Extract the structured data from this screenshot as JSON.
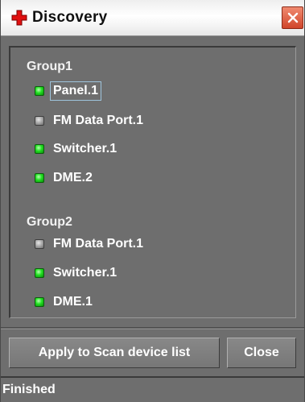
{
  "window": {
    "title": "Discovery",
    "title_icon": "red-plus-app-icon",
    "close_icon": "close-icon"
  },
  "groups": [
    {
      "label": "Group1",
      "devices": [
        {
          "name": "Panel.1",
          "status": "online",
          "focused": true
        },
        {
          "name": "FM Data Port.1",
          "status": "offline",
          "focused": false
        },
        {
          "name": "Switcher.1",
          "status": "online",
          "focused": false
        },
        {
          "name": "DME.2",
          "status": "online",
          "focused": false
        }
      ]
    },
    {
      "label": "Group2",
      "devices": [
        {
          "name": "FM Data Port.1",
          "status": "offline",
          "focused": false
        },
        {
          "name": "Switcher.1",
          "status": "online",
          "focused": false
        },
        {
          "name": "DME.1",
          "status": "online",
          "focused": false
        }
      ]
    }
  ],
  "buttons": {
    "apply_label": "Apply to Scan device list",
    "close_label": "Close"
  },
  "status": {
    "text": "Finished"
  },
  "colors": {
    "online_led": "#22e022",
    "offline_led": "#a6a6a6",
    "background": "#6e6e6e",
    "close_button": "#d0452a"
  }
}
